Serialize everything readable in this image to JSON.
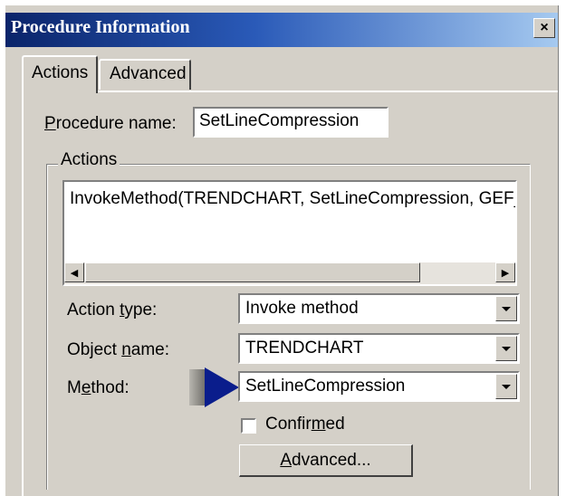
{
  "window": {
    "title": "Procedure Information",
    "close_glyph": "×"
  },
  "tabs": [
    {
      "label": "Actions",
      "selected": true
    },
    {
      "label": "Advanced",
      "selected": false
    }
  ],
  "procedure": {
    "label_accel": "P",
    "label_rest": "rocedure name:",
    "value": "SetLineCompression"
  },
  "actions_group": {
    "title": "Actions",
    "list_text": "InvokeMethod(TRENDCHART, SetLineCompression, GEF_N",
    "scroll_left_glyph": "◀",
    "scroll_right_glyph": "▶"
  },
  "action_type": {
    "label_pre": "Action ",
    "label_accel": "t",
    "label_post": "ype:",
    "value": "Invoke method"
  },
  "object_name": {
    "label_pre": "Object ",
    "label_accel": "n",
    "label_post": "ame:",
    "value": "TRENDCHART"
  },
  "method": {
    "label_pre": "M",
    "label_accel": "e",
    "label_post": "thod:",
    "value": "SetLineCompression"
  },
  "confirmed": {
    "label_pre": "Confir",
    "label_accel": "m",
    "label_post": "ed",
    "checked": false
  },
  "advanced_button": {
    "label_accel": "A",
    "label_rest": "dvanced..."
  },
  "colors": {
    "dialog_bg": "#d4d0c8",
    "titlebar_start": "#0a246a",
    "titlebar_end": "#a6caf0",
    "arrow": "#0a1d8c"
  },
  "icons": [
    "close-icon",
    "scroll-left-icon",
    "scroll-right-icon",
    "dropdown-arrow-icon",
    "pointer-arrow-icon"
  ]
}
